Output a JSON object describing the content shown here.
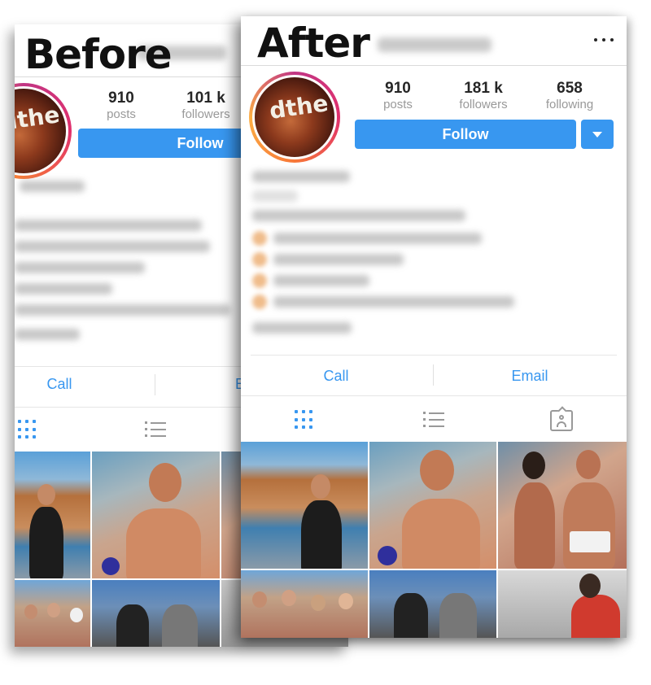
{
  "before": {
    "label": "Before",
    "stats": [
      {
        "num": "910",
        "label": "posts"
      },
      {
        "num": "101 k",
        "label": "followers"
      }
    ],
    "follow_label": "Follow",
    "actions": [
      {
        "label": "Call"
      },
      {
        "label": "E"
      }
    ]
  },
  "after": {
    "label": "After",
    "stats": [
      {
        "num": "910",
        "label": "posts"
      },
      {
        "num": "181 k",
        "label": "followers"
      },
      {
        "num": "658",
        "label": "following"
      }
    ],
    "follow_label": "Follow",
    "actions": [
      {
        "label": "Call"
      },
      {
        "label": "Email"
      }
    ]
  },
  "avatar_text": "dthe",
  "icons": {
    "more": "more-horizontal-icon",
    "dropdown": "chevron-down-icon",
    "grid": "grid-view-icon",
    "list": "list-view-icon",
    "tagged": "tagged-photos-icon"
  },
  "colors": {
    "accent": "#3897f0",
    "text": "#262626",
    "muted": "#999999",
    "divider": "#dbdbdb"
  }
}
